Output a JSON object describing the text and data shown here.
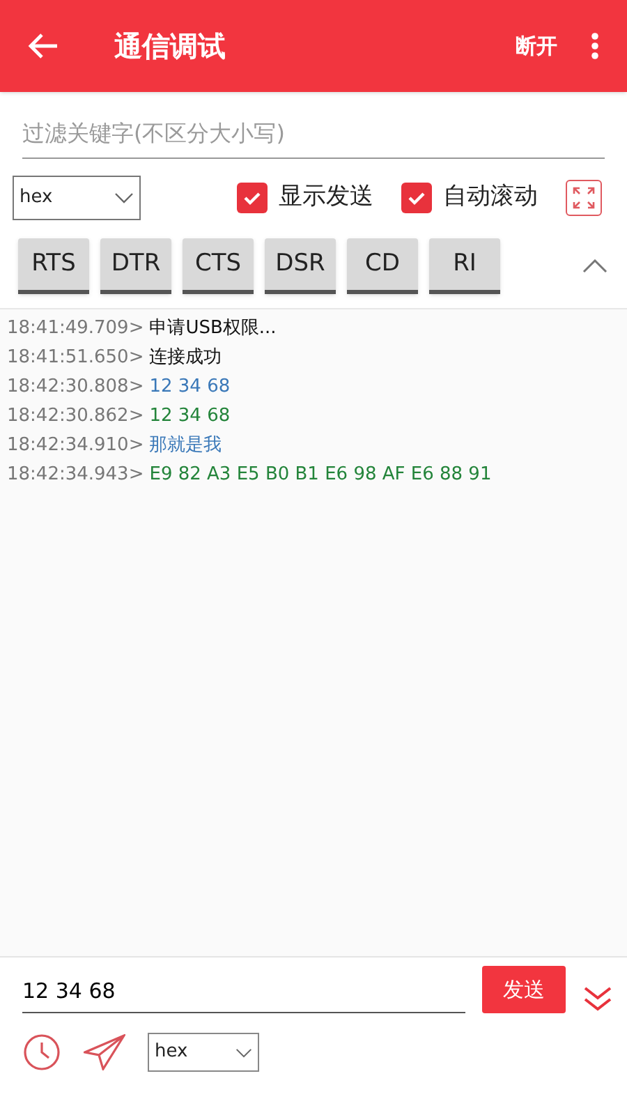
{
  "header": {
    "title": "通信调试",
    "action": "断开"
  },
  "filter": {
    "placeholder": "过滤关键字(不区分大小写)"
  },
  "options": {
    "format": "hex",
    "checks": [
      {
        "label": "显示发送",
        "checked": true
      },
      {
        "label": "自动滚动",
        "checked": true
      }
    ]
  },
  "signals": [
    {
      "label": "RTS"
    },
    {
      "label": "DTR"
    },
    {
      "label": "CTS"
    },
    {
      "label": "DSR"
    },
    {
      "label": "CD"
    },
    {
      "label": "RI"
    }
  ],
  "log": [
    {
      "time": "18:41:49.709>",
      "text": "申请USB权限...",
      "kind": "info"
    },
    {
      "time": "18:41:51.650>",
      "text": "连接成功",
      "kind": "info"
    },
    {
      "time": "18:42:30.808>",
      "text": "12 34 68",
      "kind": "sent"
    },
    {
      "time": "18:42:30.862>",
      "text": "12 34 68",
      "kind": "received"
    },
    {
      "time": "18:42:34.910>",
      "text": "那就是我",
      "kind": "sent"
    },
    {
      "time": "18:42:34.943>",
      "text": "E9 82 A3 E5 B0 B1 E6 98 AF E6 88 91",
      "kind": "received"
    }
  ],
  "input": {
    "value": "12 34 68",
    "send": "发送",
    "format": "hex"
  }
}
